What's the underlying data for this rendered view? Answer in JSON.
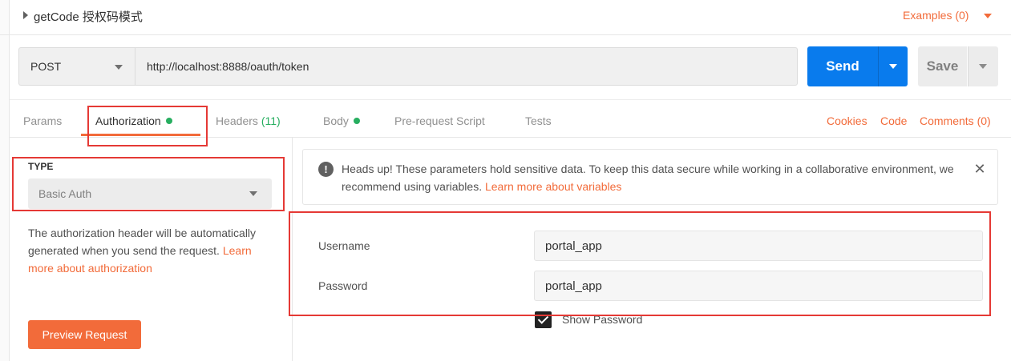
{
  "request": {
    "name": "getCode 授权码模式",
    "examples_label": "Examples (0)"
  },
  "url_bar": {
    "method": "POST",
    "url": "http://localhost:8888/oauth/token",
    "send_label": "Send",
    "save_label": "Save"
  },
  "tabs": [
    {
      "label": "Params"
    },
    {
      "label": "Authorization",
      "indicator": true
    },
    {
      "label": "Headers",
      "count": "(11)"
    },
    {
      "label": "Body",
      "indicator": true
    },
    {
      "label": "Pre-request Script"
    },
    {
      "label": "Tests"
    }
  ],
  "right_links": {
    "cookies": "Cookies",
    "code": "Code",
    "comments": "Comments (0)"
  },
  "auth": {
    "type_heading": "TYPE",
    "type_value": "Basic Auth",
    "description": "The authorization header will be automatically generated when you send the request.",
    "description_link": "Learn more about authorization",
    "preview_label": "Preview Request"
  },
  "warning": {
    "text": "Heads up! These parameters hold sensitive data. To keep this data secure while working in a collaborative environment, we recommend using variables.",
    "link": "Learn more about variables"
  },
  "fields": {
    "username_label": "Username",
    "username_value": "portal_app",
    "password_label": "Password",
    "password_value": "portal_app",
    "show_password_label": "Show Password",
    "show_password_checked": true
  },
  "colors": {
    "accent": "#f26b3a",
    "send_blue": "#097bed",
    "indicator_green": "#27ae60",
    "annotation_red": "#e53935"
  }
}
